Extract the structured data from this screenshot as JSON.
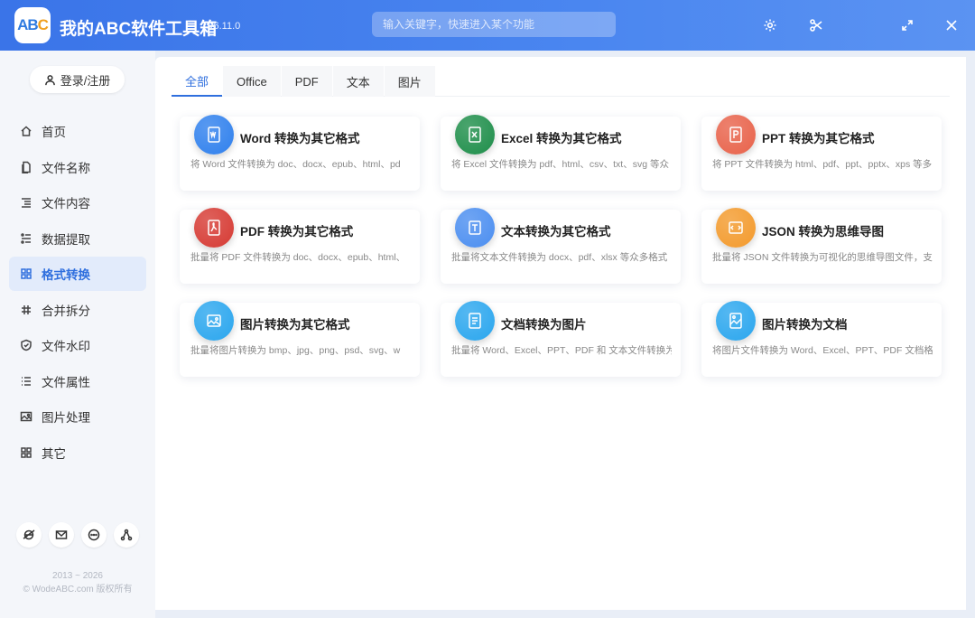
{
  "app": {
    "title": "我的ABC软件工具箱",
    "version": "v6.11.0",
    "logo_text": "AB",
    "logo_accent": "C"
  },
  "search": {
    "placeholder": "输入关键字，快速进入某个功能"
  },
  "window_controls": [
    "gear-icon",
    "scissors-icon",
    "maximize-icon",
    "close-icon"
  ],
  "sidebar": {
    "login_label": "登录/注册",
    "items": [
      {
        "label": "首页",
        "icon": "home-icon"
      },
      {
        "label": "文件名称",
        "icon": "file-icon"
      },
      {
        "label": "文件内容",
        "icon": "list-icon"
      },
      {
        "label": "数据提取",
        "icon": "extract-icon"
      },
      {
        "label": "格式转换",
        "icon": "grid-icon",
        "active": true
      },
      {
        "label": "合并拆分",
        "icon": "hash-icon"
      },
      {
        "label": "文件水印",
        "icon": "shield-icon"
      },
      {
        "label": "文件属性",
        "icon": "list-icon"
      },
      {
        "label": "图片处理",
        "icon": "image-icon"
      },
      {
        "label": "其它",
        "icon": "apps-icon"
      }
    ],
    "social": [
      "ie-icon",
      "mail-icon",
      "chat-icon",
      "share-icon"
    ],
    "copyright_line1": "2013 ~ 2026",
    "copyright_line2": "© WodeABC.com 版权所有"
  },
  "tabs": [
    {
      "label": "全部",
      "active": true
    },
    {
      "label": "Office"
    },
    {
      "label": "PDF"
    },
    {
      "label": "文本"
    },
    {
      "label": "图片"
    }
  ],
  "cards": [
    {
      "title": "Word 转换为其它格式",
      "desc": "将 Word 文件转换为 doc、docx、epub、html、pd",
      "color": "#2f80ed",
      "icon": "word-icon"
    },
    {
      "title": "Excel 转换为其它格式",
      "desc": "将 Excel 文件转换为 pdf、html、csv、txt、svg 等众",
      "color": "#1e8e4a",
      "icon": "excel-icon"
    },
    {
      "title": "PPT 转换为其它格式",
      "desc": "将 PPT 文件转换为 html、pdf、ppt、pptx、xps 等多",
      "color": "#e8624a",
      "icon": "ppt-icon"
    },
    {
      "title": "PDF 转换为其它格式",
      "desc": "批量将 PDF 文件转换为 doc、docx、epub、html、",
      "color": "#d63a33",
      "icon": "pdf-icon"
    },
    {
      "title": "文本转换为其它格式",
      "desc": "批量将文本文件转换为 docx、pdf、xlsx 等众多格式",
      "color": "#4b8ef0",
      "icon": "text-icon"
    },
    {
      "title": "JSON 转换为思维导图",
      "desc": "批量将 JSON 文件转换为可视化的思维导图文件，支",
      "color": "#f39a2c",
      "icon": "json-icon"
    },
    {
      "title": "图片转换为其它格式",
      "desc": "批量将图片转换为 bmp、jpg、png、psd、svg、w",
      "color": "#2aa6ee",
      "icon": "image-icon"
    },
    {
      "title": "文档转换为图片",
      "desc": "批量将 Word、Excel、PPT、PDF 和 文本文件转换为",
      "color": "#2aa6ee",
      "icon": "doc-image-icon"
    },
    {
      "title": "图片转换为文档",
      "desc": "将图片文件转换为 Word、Excel、PPT、PDF 文档格",
      "color": "#2aa6ee",
      "icon": "image-doc-icon"
    }
  ]
}
